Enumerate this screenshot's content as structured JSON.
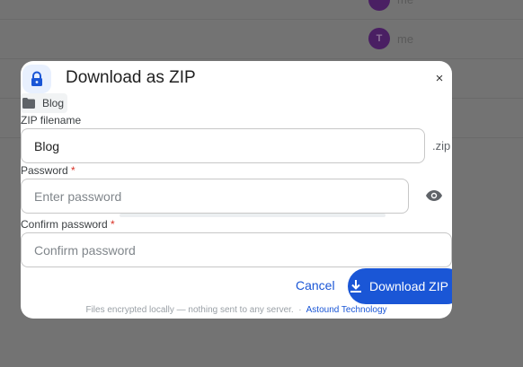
{
  "background": {
    "rows": [
      {
        "initial": "",
        "name": "me"
      },
      {
        "initial": "T",
        "name": "me"
      }
    ]
  },
  "dialog": {
    "title": "Download as ZIP",
    "close_glyph": "×",
    "folder_name": "Blog",
    "zip_filename_label": "ZIP filename",
    "zip_filename_value": "Blog",
    "zip_suffix": ".zip",
    "password_label": "Password",
    "password_placeholder": "Enter password",
    "confirm_label": "Confirm password",
    "confirm_placeholder": "Confirm password",
    "required_mark": "*",
    "cancel_label": "Cancel",
    "download_label": "Download ZIP",
    "footer_text": "Files encrypted locally — nothing sent to any server.",
    "footer_separator": "·",
    "footer_link": "Astound Technology"
  },
  "icons": {
    "lock": "lock-icon",
    "folder": "folder-icon",
    "eye": "eye-icon",
    "download": "download-icon",
    "close": "close-icon"
  },
  "colors": {
    "accent": "#1a56d6",
    "required": "#d93025",
    "overlay": "#737373"
  }
}
